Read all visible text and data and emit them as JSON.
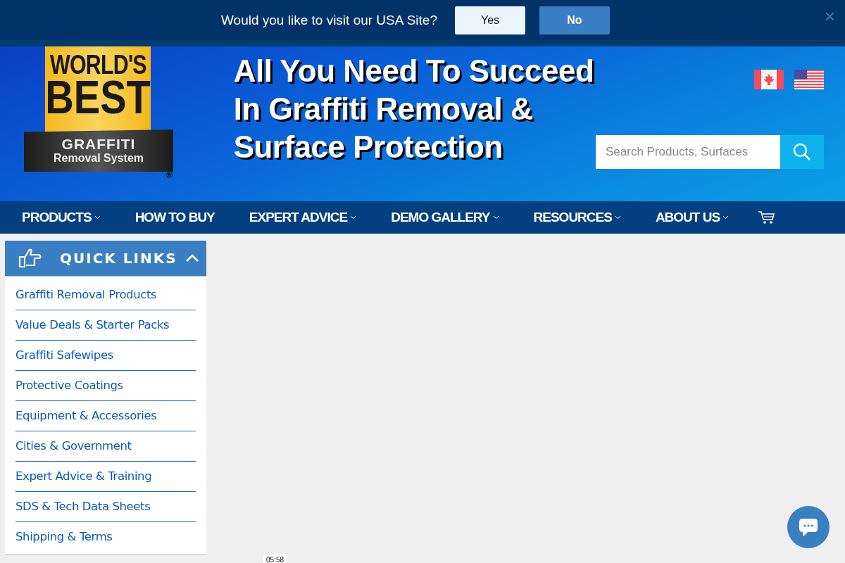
{
  "site_prompt": {
    "question": "Would you like to visit our USA Site?",
    "buttons": [
      {
        "label": "Yes",
        "kind": "light"
      },
      {
        "label": "No",
        "kind": "primary"
      }
    ],
    "close": "×"
  },
  "logo": {
    "lines": [
      "WORLD'S",
      "BEST"
    ],
    "ribbon": [
      "GRAFFITI",
      "Removal System"
    ],
    "mark": "®"
  },
  "headline": "All You Need To Succeed In Graffiti Removal & Surface Protection",
  "search": {
    "placeholder": "Search Products, Surfaces"
  },
  "nav": [
    {
      "label": "PRODUCTS",
      "dropdown": true
    },
    {
      "label": "HOW TO BUY",
      "dropdown": false
    },
    {
      "label": "EXPERT ADVICE",
      "dropdown": true
    },
    {
      "label": "DEMO GALLERY",
      "dropdown": true
    },
    {
      "label": "RESOURCES",
      "dropdown": true
    },
    {
      "label": "ABOUT US",
      "dropdown": true
    }
  ],
  "quick_links": {
    "title": "QUICK LINKS",
    "expanded": true,
    "items": [
      "Graffiti Removal Products",
      "Value Deals & Starter Packs",
      "Graffiti Safewipes",
      "Protective Coatings",
      "Equipment & Accessories",
      "Cities & Government",
      "Expert Advice & Training",
      "SDS & Tech Data Sheets",
      "Shipping & Terms"
    ]
  },
  "timestamp": "05:58"
}
